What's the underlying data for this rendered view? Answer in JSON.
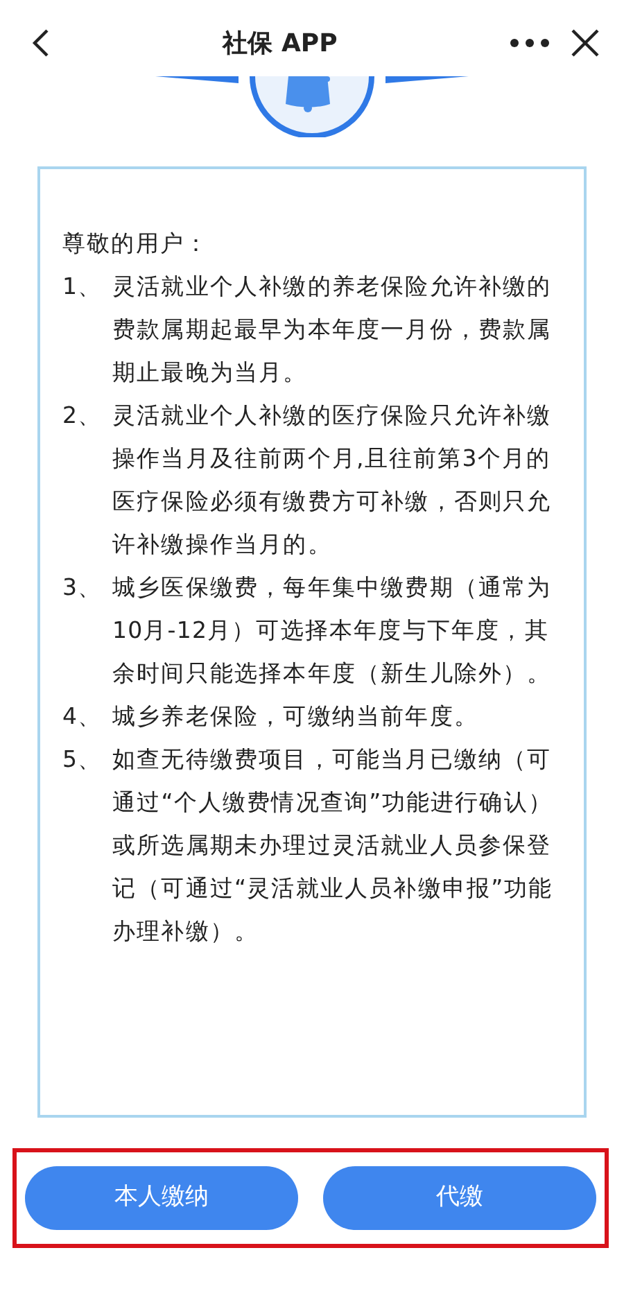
{
  "header": {
    "title": "社保 APP"
  },
  "notice": {
    "greeting": "尊敬的用户：",
    "items": [
      {
        "number": "1、",
        "text": "灵活就业个人补缴的养老保险允许补缴的费款属期起最早为本年度一月份，费款属期止最晚为当月。"
      },
      {
        "number": "2、",
        "text": "灵活就业个人补缴的医疗保险只允许补缴操作当月及往前两个月,且往前第3个月的医疗保险必须有缴费方可补缴，否则只允许补缴操作当月的。"
      },
      {
        "number": "3、",
        "text": "城乡医保缴费，每年集中缴费期（通常为10月-12月）可选择本年度与下年度，其余时间只能选择本年度（新生儿除外）。"
      },
      {
        "number": "4、",
        "text": "城乡养老保险，可缴纳当前年度。"
      },
      {
        "number": "5、",
        "text": "如查无待缴费项目，可能当月已缴纳（可通过“个人缴费情况查询”功能进行确认）或所选属期未办理过灵活就业人员参保登记（可通过“灵活就业人员补缴申报”功能办理补缴）。"
      }
    ]
  },
  "buttons": [
    {
      "label": "本人缴纳"
    },
    {
      "label": "代缴"
    }
  ]
}
